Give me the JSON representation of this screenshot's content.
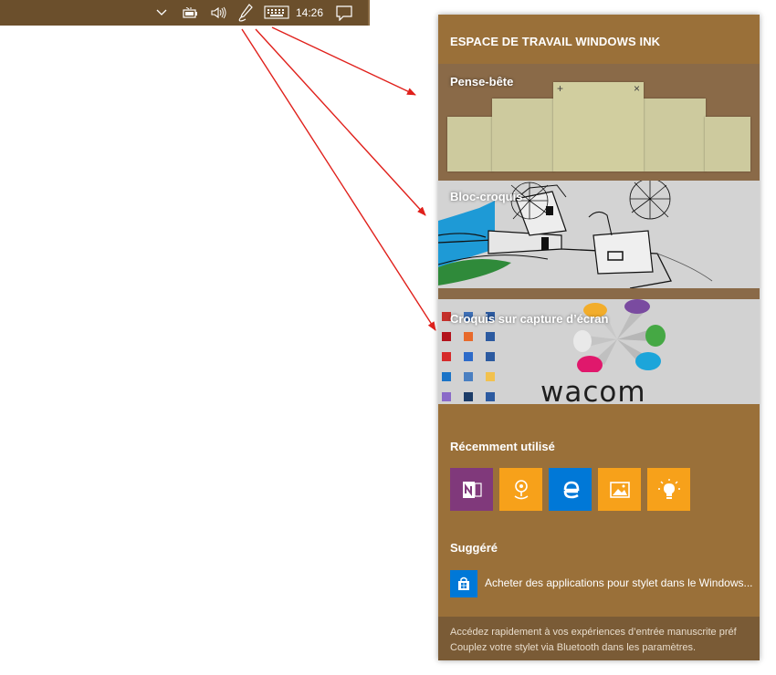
{
  "taskbar": {
    "clock": "14:26",
    "icons": [
      "chevron-up-icon",
      "battery-icon",
      "volume-icon",
      "pen-icon",
      "keyboard-icon",
      "notification-icon"
    ],
    "background": "#6b4f2c"
  },
  "annotation": {
    "arrow_color": "#e0201b"
  },
  "panel": {
    "title": "ESPACE DE TRAVAIL WINDOWS INK",
    "accent": "#9a7039",
    "tiles": [
      {
        "label": "Pense-bête"
      },
      {
        "label": "Bloc-croquis"
      },
      {
        "label": "Croquis sur capture d’écran"
      }
    ],
    "sticky_note_glyphs": {
      "add": "+",
      "close": "×"
    },
    "screen_logo_text": "wacom",
    "recent_title": "Récemment utilisé",
    "recent_apps": [
      {
        "icon": "onenote-icon",
        "color": "#80397b"
      },
      {
        "icon": "maps-icon",
        "color": "#f7a11a"
      },
      {
        "icon": "edge-icon",
        "color": "#0078d7"
      },
      {
        "icon": "photos-icon",
        "color": "#f7a11a"
      },
      {
        "icon": "tips-icon",
        "color": "#f7a11a"
      }
    ],
    "suggested_title": "Suggéré",
    "suggested_item": "Acheter des applications pour stylet dans le Windows...",
    "footer_line1": "Accédez rapidement à vos expériences d’entrée manuscrite préf",
    "footer_line2": "Couplez votre stylet via Bluetooth dans les paramètres."
  }
}
